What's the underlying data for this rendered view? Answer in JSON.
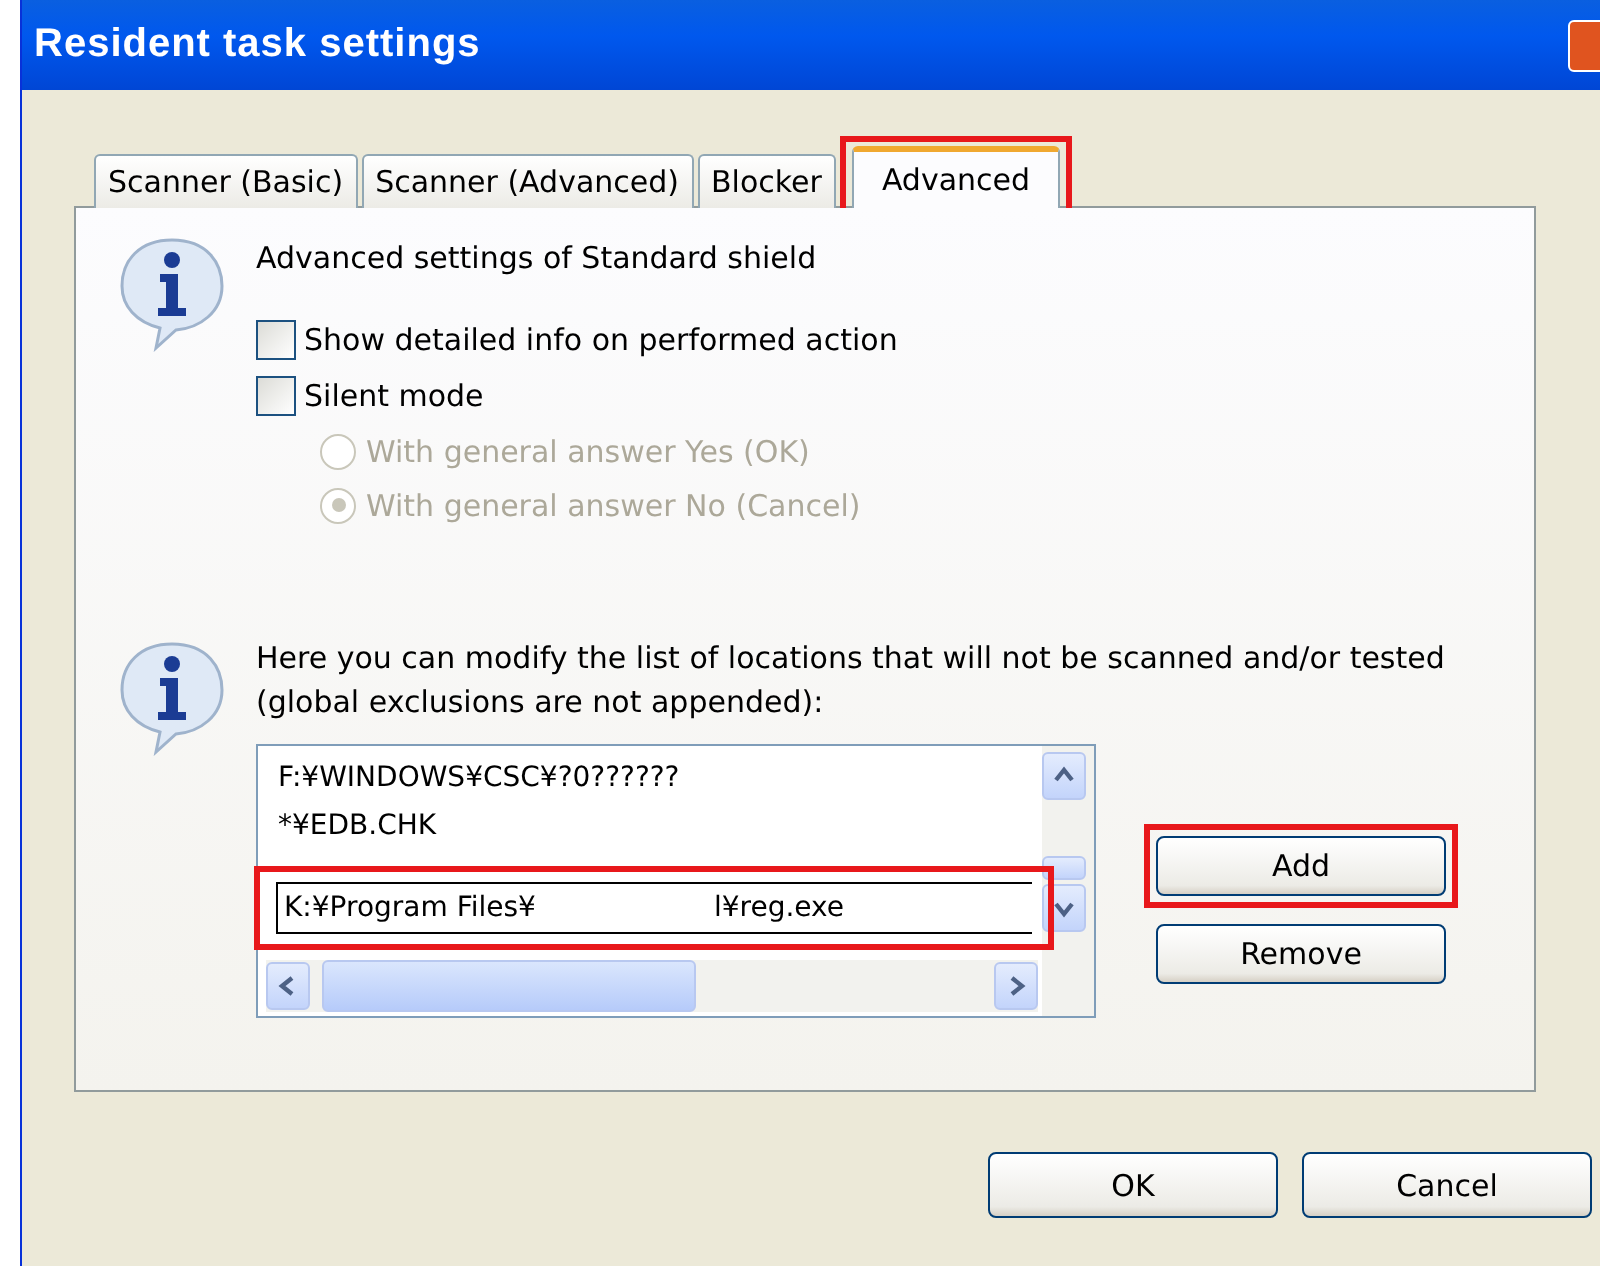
{
  "window": {
    "title": "Resident task settings"
  },
  "tabs": [
    {
      "label": "Scanner (Basic)",
      "selected": false,
      "highlighted": false
    },
    {
      "label": "Scanner (Advanced)",
      "selected": false,
      "highlighted": false
    },
    {
      "label": "Blocker",
      "selected": false,
      "highlighted": false
    },
    {
      "label": "Advanced",
      "selected": true,
      "highlighted": true
    }
  ],
  "shield_section": {
    "heading": "Advanced settings of Standard shield",
    "checkboxes": [
      {
        "label": "Show detailed info on performed action",
        "checked": false
      },
      {
        "label": "Silent mode",
        "checked": false
      }
    ],
    "radios": [
      {
        "label": "With general answer Yes (OK)",
        "selected": false,
        "disabled": true
      },
      {
        "label": "With general answer No (Cancel)",
        "selected": true,
        "disabled": true
      }
    ]
  },
  "exclusions_section": {
    "description": "Here you can modify the list of locations that will not be scanned and/or tested (global exclusions are not appended):",
    "items": [
      "F:¥WINDOWS¥CSC¥?0??????",
      "*¥EDB.CHK"
    ],
    "edit_value": "K:¥Program Files¥                    l¥reg.exe",
    "edit_highlighted": true,
    "buttons": [
      {
        "label": "Add",
        "highlighted": true
      },
      {
        "label": "Remove",
        "highlighted": false
      }
    ]
  },
  "buttons": [
    "OK",
    "Cancel"
  ]
}
